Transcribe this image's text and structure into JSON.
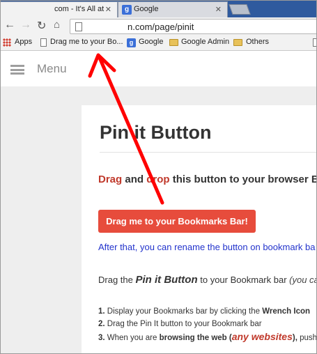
{
  "tabs": [
    {
      "title": "com - It's All at",
      "active": true
    },
    {
      "title": "Google",
      "active": false
    }
  ],
  "toolbar": {
    "url": "n.com/page/pinit"
  },
  "bookmarks": {
    "apps": "Apps",
    "drag": "Drag me to your Bo...",
    "google": "Google",
    "google_admin": "Google Admin",
    "others": "Others"
  },
  "header": {
    "menu_label": "Menu"
  },
  "content": {
    "title": "Pin it Button",
    "drag_word": "Drag",
    "and_word": " and ",
    "drop_word": "drop",
    "drag_rest": " this button to your browser Bookm",
    "button_label": "Drag me to your Bookmarks Bar!",
    "after_text": "After that, you can rename the button on bookmark ba",
    "drag_the": "Drag the ",
    "pin_it_button": "Pin it Button",
    "to_bookmark_bar": " to your Bookmark bar ",
    "you_can": "(you can",
    "steps": [
      {
        "num": "1.",
        "text_a": " Display your Bookmarks bar by clicking the ",
        "bold": "Wrench Icon"
      },
      {
        "num": "2.",
        "text_a": " Drag the Pin It button to your Bookmark bar",
        "bold": ""
      },
      {
        "num": "3.",
        "text_a": " When you are ",
        "bold": "browsing the web (",
        "red": "any websites",
        "bold2": "),",
        "tail": " push t"
      }
    ]
  },
  "colors": {
    "accent_red": "#e74c3c",
    "arrow_red": "#ff0000",
    "link_blue": "#2233cc"
  }
}
